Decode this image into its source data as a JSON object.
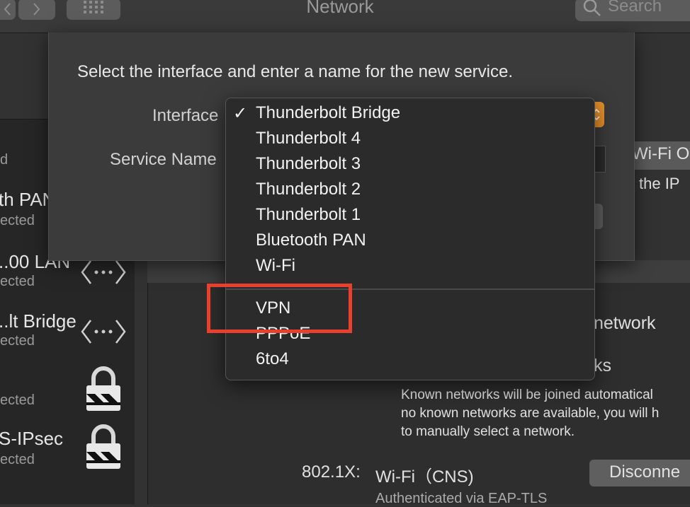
{
  "toolbar": {
    "title": "Network",
    "search_placeholder": "Search",
    "back_icon": "chevron-left-icon",
    "forward_icon": "chevron-right-icon",
    "grid_icon": "grid-icon"
  },
  "sidebar": {
    "header": "d",
    "items": [
      {
        "name": "th PAN",
        "status": "ected",
        "icon": ""
      },
      {
        "name": "..00 LAN",
        "status": "ected",
        "icon": "ethernet-icon"
      },
      {
        "name": "..lt Bridge",
        "status": "ected",
        "icon": "ethernet-icon"
      },
      {
        "name": "",
        "status": "ected",
        "icon": "lock-icon"
      },
      {
        "name": "S-IPsec",
        "status": "ected",
        "icon": "lock-icon"
      }
    ]
  },
  "sheet": {
    "message": "Select the interface and enter a name for the new service.",
    "interface_label": "Interface",
    "service_name_label": "Service Name"
  },
  "menu": {
    "checked_index": 0,
    "group1": [
      "Thunderbolt Bridge",
      "Thunderbolt 4",
      "Thunderbolt 3",
      "Thunderbolt 2",
      "Thunderbolt 1",
      "Bluetooth PAN",
      "Wi-Fi"
    ],
    "group2": [
      "VPN",
      "PPPoE",
      "6to4"
    ]
  },
  "main": {
    "wifi_button": "Wi-Fi O",
    "ip_text": "the IP",
    "network_text": "network",
    "ks_text": "ks",
    "known_networks_text": [
      "Known networks will be joined automatical",
      "no known networks are available, you will h",
      "to manually select a network."
    ],
    "dot1x_label": "802.1X:",
    "dot1x_value": "Wi-Fi（CNS)",
    "disconnect_button": "Disconne",
    "auth_text": "Authenticated via EAP-TLS"
  },
  "colors": {
    "highlight_box": "#e8402c",
    "popup_arrow": "#e8902a"
  }
}
